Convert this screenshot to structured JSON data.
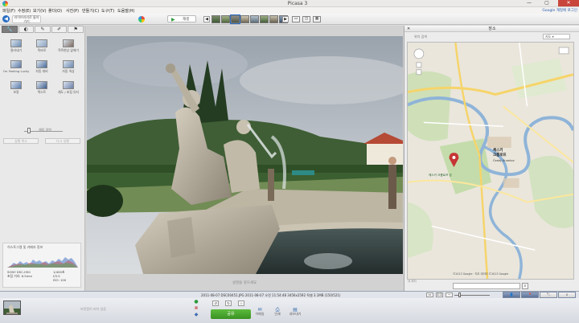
{
  "window": {
    "title": "Picasa 3",
    "minimize": "—",
    "maximize": "▢",
    "close": "✕"
  },
  "menu": {
    "items": [
      "파일(F)",
      "수정(E)",
      "보기(V)",
      "폴더(O)",
      "사진(P)",
      "만들기(C)",
      "도구(T)",
      "도움말(H)"
    ],
    "account": "Google 계정에 로그인"
  },
  "toolbar": {
    "back_label": "라이브러리로 돌아가기",
    "slideshow_label": "재생",
    "prev_icon": "◀",
    "next_icon": "▶",
    "view_icons": [
      "▭",
      "◫",
      "▦"
    ]
  },
  "left_panel": {
    "tabs": [
      "🔧",
      "◐",
      "✎",
      "✐",
      "⚑"
    ],
    "effects": [
      {
        "label": "잘라내기",
        "color": "#6f8fb3"
      },
      {
        "label": "똑바로",
        "color": "#8aa2bf"
      },
      {
        "label": "적목현상 없애기",
        "color": "#7d6a5f"
      },
      {
        "label": "I'm Feeling Lucky",
        "color": "#5c7aa6"
      },
      {
        "label": "자동 대비",
        "color": "#4b6b99"
      },
      {
        "label": "자동 색상",
        "color": "#6b88b0"
      },
      {
        "label": "보정",
        "color": "#5a7bab"
      },
      {
        "label": "텍스트",
        "color": "#3d5c8c"
      },
      {
        "label": "채도 / 초점 유지",
        "color": "#6b7fa8"
      }
    ],
    "fill_light_label": "채움 광원",
    "fill_light_value": 0.12,
    "undo_label": "실행 취소",
    "redo_label": "다시 실행",
    "histogram_title": "히스토그램 및 카메라 정보",
    "exif_left": [
      "SONY DSC-H50",
      "초점 거리: 6.5mm"
    ],
    "exif_right": [
      "1/400초",
      "f/3.5",
      "ISO: 100"
    ]
  },
  "main": {
    "caption_hint": "설명을 넣으세요"
  },
  "right_panel": {
    "title": "장소",
    "search_hint": "위치 검색",
    "map_type": "지도 ▾",
    "attribution": "©2013 Google · 지도 데이터 ©2013 Google",
    "corner_note": "내 위치",
    "labels": [
      {
        "text": "체스키\n크룸로프",
        "color": "#222"
      },
      {
        "text": "Český Krumlov",
        "color": "#333"
      },
      {
        "text": "체스키 크룸로프 성",
        "color": "#1f5d2a"
      }
    ]
  },
  "status": {
    "info": "2011-08-07  DSC00451.JPG  2011-08-07 오전 11:54:48  3456x2592 픽셀  3.1MB  (150/521)",
    "share_button": "공유",
    "tools": [
      "이메일",
      "인쇄",
      "내보내기"
    ]
  },
  "tray": {
    "hold_text": "보관함이 비어 있음"
  }
}
